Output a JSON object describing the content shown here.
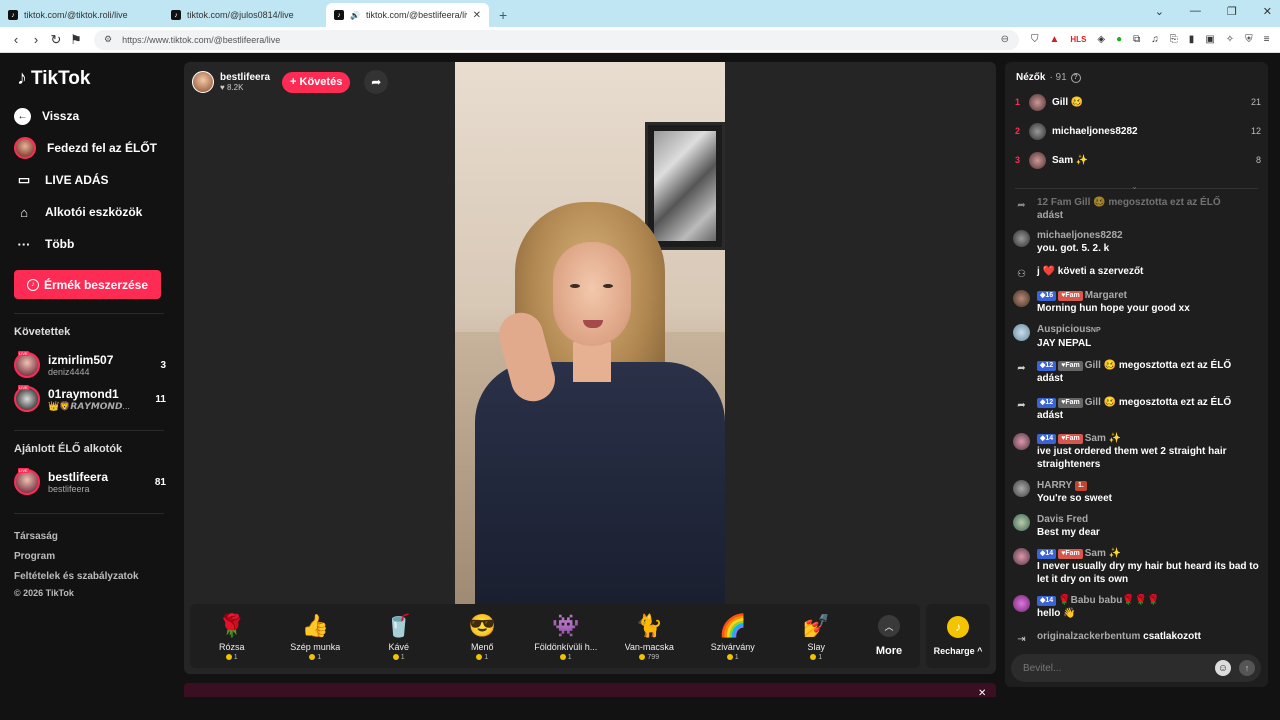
{
  "browser": {
    "tabs": [
      {
        "title": "tiktok.com/@tiktok.roli/live",
        "active": false
      },
      {
        "title": "tiktok.com/@julos0814/live",
        "active": false
      },
      {
        "title": "tiktok.com/@bestlifeera/live",
        "active": true
      }
    ],
    "url": "https://www.tiktok.com/@bestlifeera/live",
    "ext_label": "HLS"
  },
  "sidebar": {
    "logo": "TikTok",
    "nav": [
      {
        "label": "Vissza",
        "icon": "arrow-left-icon"
      },
      {
        "label": "Fedezd fel az ÉLŐT",
        "icon": "live-avatar-icon"
      },
      {
        "label": "LIVE ADÁS",
        "icon": "video-camera-icon"
      },
      {
        "label": "Alkotói eszközök",
        "icon": "creator-tools-icon"
      },
      {
        "label": "Több",
        "icon": "ellipsis-icon"
      }
    ],
    "coin_button": "Érmék beszerzése",
    "following_title": "Követettek",
    "following": [
      {
        "name": "izmirlim507",
        "sub": "deniz4444",
        "count": "3"
      },
      {
        "name": "01raymond1",
        "sub": "👑🦁𝙍𝘼𝙔𝙈𝙊𝙉𝘿...",
        "count": "11"
      }
    ],
    "suggested_title": "Ajánlott ÉLŐ alkotók",
    "suggested": [
      {
        "name": "bestlifeera",
        "sub": "bestlifeera",
        "count": "81"
      }
    ],
    "footer_links": [
      "Társaság",
      "Program",
      "Feltételek és szabályzatok"
    ],
    "copyright": "© 2026 TikTok"
  },
  "stream": {
    "host": "bestlifeera",
    "likes": "8.2K",
    "follow_label": "+ Követés",
    "gifts": [
      {
        "name": "Rózsa",
        "price": "1",
        "icon": "🌹"
      },
      {
        "name": "Szép munka",
        "price": "1",
        "icon": "👍"
      },
      {
        "name": "Kávé",
        "price": "1",
        "icon": "🥤"
      },
      {
        "name": "Menő",
        "price": "1",
        "icon": "😎"
      },
      {
        "name": "Földönkívüli h...",
        "price": "1",
        "icon": "👾"
      },
      {
        "name": "Van-macska",
        "price": "799",
        "icon": "🐈"
      },
      {
        "name": "Szivárvány",
        "price": "1",
        "icon": "🌈"
      },
      {
        "name": "Slay",
        "price": "1",
        "icon": "💅"
      }
    ],
    "more_label": "More",
    "recharge_label": "Recharge ^"
  },
  "chat": {
    "viewers_label": "Nézők",
    "viewers_count": "· 91",
    "top_viewers": [
      {
        "rank": "1",
        "name": "Gill 🥴",
        "score": "21"
      },
      {
        "rank": "2",
        "name": "michaeljones8282",
        "score": "12"
      },
      {
        "rank": "3",
        "name": "Sam ✨",
        "score": "8"
      }
    ],
    "messages": [
      {
        "user": "12 Fam Gill 🥴 megosztotta ezt az ÉLŐ",
        "text": "adást",
        "icon": "share-icon"
      },
      {
        "user": "michaeljones8282",
        "text": "you. got. 5. 2. k",
        "icon": "avatar"
      },
      {
        "user": "",
        "text": "j ❤️ követi a szervezőt",
        "icon": "follow-icon"
      },
      {
        "badge1": "16",
        "badge2": "Fam",
        "user": "Margaret",
        "text": "Morning hun hope your good xx",
        "icon": "avatar"
      },
      {
        "user": "Auspicious",
        "tag": "NP",
        "text": "JAY NEPAL",
        "icon": "avatar"
      },
      {
        "badge1": "12",
        "badge2": "Fam",
        "user": "Gill 🥴",
        "action": "megosztotta ezt az ÉLŐ",
        "text": "adást",
        "icon": "share-icon"
      },
      {
        "badge1": "12",
        "badge2": "Fam",
        "user": "Gill 🥴",
        "action": "megosztotta ezt az ÉLŐ",
        "text": "adást",
        "icon": "share-icon"
      },
      {
        "badge1": "14",
        "badge2": "Fam",
        "user": "Sam ✨",
        "text": "ive just ordered them wet 2 straight hair straighteners",
        "icon": "avatar"
      },
      {
        "user": "HARRY",
        "badge3": "1.",
        "text": "You're so sweet",
        "icon": "avatar"
      },
      {
        "user": "Davis Fred",
        "text": "Best my dear",
        "icon": "avatar"
      },
      {
        "badge1": "14",
        "badge2": "Fam",
        "user": "Sam ✨",
        "text": "I never usually dry my hair but heard its bad to let it dry on its own",
        "icon": "avatar"
      },
      {
        "badge1": "14",
        "user": "🌹Babu babu🌹🌹🌹",
        "text": "hello 👋",
        "icon": "avatar"
      },
      {
        "user": "originalzackerbentum",
        "action": "csatlakozott",
        "text": "",
        "icon": "join-icon"
      }
    ],
    "input_placeholder": "Bevitel..."
  }
}
